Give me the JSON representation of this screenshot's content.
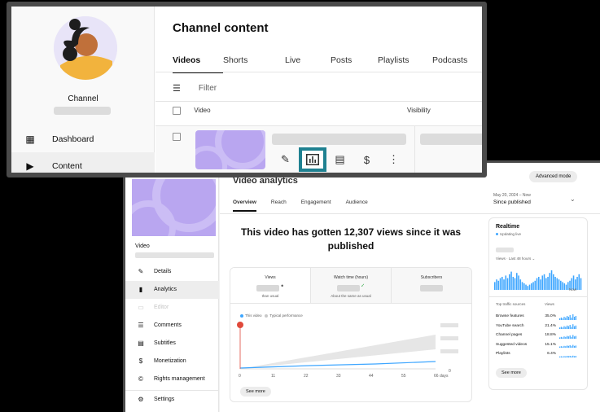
{
  "channel_window": {
    "title": "Channel content",
    "channel_name": "Channel",
    "nav": [
      {
        "label": "Dashboard",
        "icon": "dashboard-icon"
      },
      {
        "label": "Content",
        "icon": "content-icon",
        "active": true
      }
    ],
    "tabs": [
      "Videos",
      "Shorts",
      "Live",
      "Posts",
      "Playlists",
      "Podcasts"
    ],
    "active_tab": "Videos",
    "filter_placeholder": "Filter",
    "columns": [
      "Video",
      "Visibility"
    ],
    "row_actions": [
      {
        "icon": "pencil-icon",
        "label": "Details"
      },
      {
        "icon": "analytics-icon",
        "label": "Analytics",
        "highlighted": true
      },
      {
        "icon": "comments-icon",
        "label": "Comments"
      },
      {
        "icon": "dollar-icon",
        "label": "Monetization"
      },
      {
        "icon": "more-vertical-icon",
        "label": "Options"
      }
    ],
    "highlight_color": "#1f8191"
  },
  "analytics_window": {
    "title": "Video analytics",
    "video_label": "Video",
    "nav": [
      {
        "label": "Details",
        "icon": "pencil-icon"
      },
      {
        "label": "Analytics",
        "icon": "analytics-icon",
        "active": true
      },
      {
        "label": "Editor",
        "icon": "editor-icon",
        "disabled": true
      },
      {
        "label": "Comments",
        "icon": "comments-icon"
      },
      {
        "label": "Subtitles",
        "icon": "subtitles-icon"
      },
      {
        "label": "Monetization",
        "icon": "dollar-icon"
      },
      {
        "label": "Rights management",
        "icon": "copyright-icon"
      }
    ],
    "settings_label": "Settings",
    "tabs": [
      "Overview",
      "Reach",
      "Engagement",
      "Audience"
    ],
    "active_tab": "Overview",
    "advanced_mode": "Advanced mode",
    "date_range": "May 20, 2024 – Now",
    "date_label": "Since published",
    "headline": "This video has gotten 12,307  views since it was published",
    "metrics": [
      {
        "label": "Views",
        "note": "than usual"
      },
      {
        "label": "Watch time (hours)",
        "note": "About the same as usual"
      },
      {
        "label": "Subscribers",
        "note": ""
      }
    ],
    "legend": {
      "this_video": "This video",
      "typical": "Typical performance"
    },
    "see_more": "See more",
    "realtime": {
      "title": "Realtime",
      "status": "Updating live",
      "sub": "Views · Last 48 hours",
      "now": "Now",
      "col_source": "Top traffic sources",
      "col_views": "Views",
      "sources": [
        {
          "name": "Browse features",
          "pct": "35.0%"
        },
        {
          "name": "YouTube search",
          "pct": "21.4%"
        },
        {
          "name": "Channel pages",
          "pct": "18.8%"
        },
        {
          "name": "Suggested videos",
          "pct": "15.1%"
        },
        {
          "name": "Playlists",
          "pct": "6.4%"
        }
      ],
      "see_more": "See more"
    }
  },
  "chart_data": {
    "type": "line",
    "title": "",
    "xlabel": "",
    "ylabel": "",
    "x_ticks": [
      "0",
      "11",
      "22",
      "33",
      "44",
      "55",
      "66 days"
    ],
    "y_ticks": [
      "0"
    ],
    "series": [
      {
        "name": "This video",
        "color": "#3ea6ff"
      },
      {
        "name": "Typical performance",
        "color": "#c8c8c8"
      }
    ]
  }
}
